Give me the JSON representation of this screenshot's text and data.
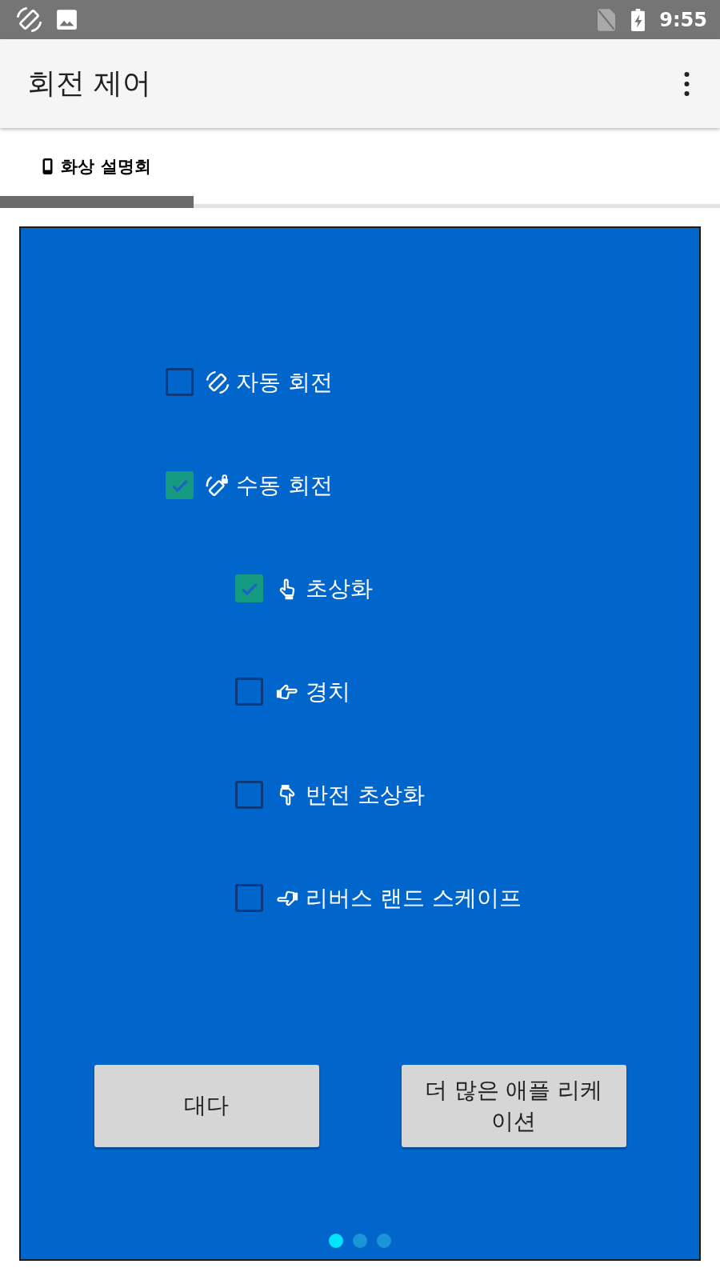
{
  "status_bar": {
    "time": "9:55"
  },
  "app_bar": {
    "title": "회전 제어"
  },
  "tabs": [
    {
      "label": "화상 설명회",
      "selected": true
    }
  ],
  "options": [
    {
      "label": "자동 회전",
      "checked": false
    },
    {
      "label": "수동 회전",
      "checked": true,
      "children": [
        {
          "label": "초상화",
          "checked": true
        },
        {
          "label": "경치",
          "checked": false
        },
        {
          "label": "반전 초상화",
          "checked": false
        },
        {
          "label": "리버스 랜드 스케이프",
          "checked": false
        }
      ]
    }
  ],
  "buttons": [
    "대다",
    "더 많은 애플 리케이션"
  ],
  "pages": [
    {
      "selected": true
    },
    {
      "selected": false
    },
    {
      "selected": false
    }
  ]
}
